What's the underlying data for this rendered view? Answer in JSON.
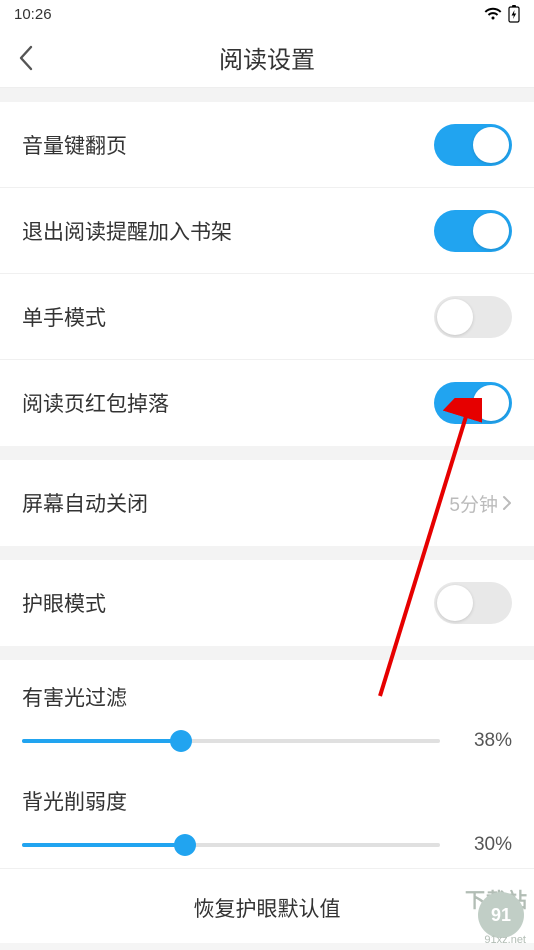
{
  "status": {
    "time": "10:26"
  },
  "header": {
    "title": "阅读设置"
  },
  "settings": {
    "volume_page": {
      "label": "音量键翻页",
      "on": true
    },
    "exit_remind": {
      "label": "退出阅读提醒加入书架",
      "on": true
    },
    "one_hand": {
      "label": "单手模式",
      "on": false
    },
    "red_packet": {
      "label": "阅读页红包掉落",
      "on": true
    },
    "screen_off": {
      "label": "屏幕自动关闭",
      "value": "5分钟"
    },
    "eye_care": {
      "label": "护眼模式",
      "on": false
    }
  },
  "sliders": {
    "light_filter": {
      "label": "有害光过滤",
      "value": 38,
      "display": "38%"
    },
    "backlight": {
      "label": "背光削弱度",
      "value": 30,
      "display": "30%"
    }
  },
  "restore": {
    "label": "恢复护眼默认值"
  },
  "watermark": {
    "brand": "下载站",
    "url": "91xz.net",
    "num": "91"
  }
}
